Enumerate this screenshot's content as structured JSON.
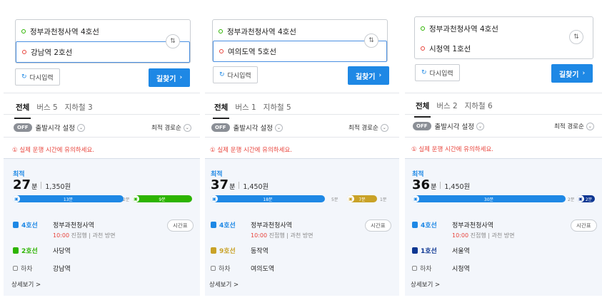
{
  "panels": [
    {
      "origin": "정부과천청사역 4호선",
      "destination": "강남역 2호선",
      "reinput": "다시입력",
      "find": "길찾기",
      "tabs": [
        "전체",
        "버스 5",
        "지하철 3"
      ],
      "off": "OFF",
      "departure": "출발시각 설정",
      "sort": "최적 경로순",
      "warning": "① 실제 운행 시간에 유의하세요.",
      "best": "최적",
      "minutes": "27",
      "unit": "분",
      "fare": "1,350원",
      "segments": [
        "13분",
        "2분",
        "9분"
      ],
      "timetable": "시간표",
      "stops": [
        {
          "line": "4호선",
          "color": "#1e88e5",
          "name": "정부과천청사역"
        },
        {
          "line": "2호선",
          "color": "#2db400",
          "name": "사당역"
        },
        {
          "line": "하차",
          "color": "#888888",
          "name": "강남역"
        }
      ],
      "sub_time": "10:00",
      "sub_text": "진접행 | 과천 방면",
      "detail": "상세보기 >"
    },
    {
      "origin": "정부과천청사역 4호선",
      "destination": "여의도역 5호선",
      "reinput": "다시입력",
      "find": "길찾기",
      "tabs": [
        "전체",
        "버스 1",
        "지하철 5"
      ],
      "off": "OFF",
      "departure": "출발시각 설정",
      "sort": "최적 경로순",
      "warning": "① 실제 운행 시간에 유의하세요.",
      "best": "최적",
      "minutes": "37",
      "unit": "분",
      "fare": "1,450원",
      "segments": [
        "18분",
        "5분",
        "7분",
        "1분"
      ],
      "timetable": "시간표",
      "stops": [
        {
          "line": "4호선",
          "color": "#1e88e5",
          "name": "정부과천청사역"
        },
        {
          "line": "9호선",
          "color": "#c9a227",
          "name": "동작역"
        },
        {
          "line": "하차",
          "color": "#888888",
          "name": "여의도역"
        }
      ],
      "sub_time": "10:00",
      "sub_text": "진접행 | 과천 방면",
      "detail": "상세보기 >"
    },
    {
      "origin": "정부과천청사역 4호선",
      "destination": "시청역 1호선",
      "reinput": "다시입력",
      "find": "길찾기",
      "tabs": [
        "전체",
        "버스 2",
        "지하철 6"
      ],
      "off": "OFF",
      "departure": "출발시각 설정",
      "sort": "최적 경로순",
      "warning": "① 실제 운행 시간에 유의하세요.",
      "best": "최적",
      "minutes": "36",
      "unit": "분",
      "fare": "1,450원",
      "segments": [
        "30분",
        "2분",
        "2분"
      ],
      "timetable": "시간표",
      "stops": [
        {
          "line": "4호선",
          "color": "#1e88e5",
          "name": "정부과천청사역"
        },
        {
          "line": "1호선",
          "color": "#0d3692",
          "name": "서울역"
        },
        {
          "line": "하차",
          "color": "#888888",
          "name": "시청역"
        }
      ],
      "sub_time": "10:00",
      "sub_text": "진접행 | 과천 방면",
      "detail": "상세보기 >"
    }
  ]
}
